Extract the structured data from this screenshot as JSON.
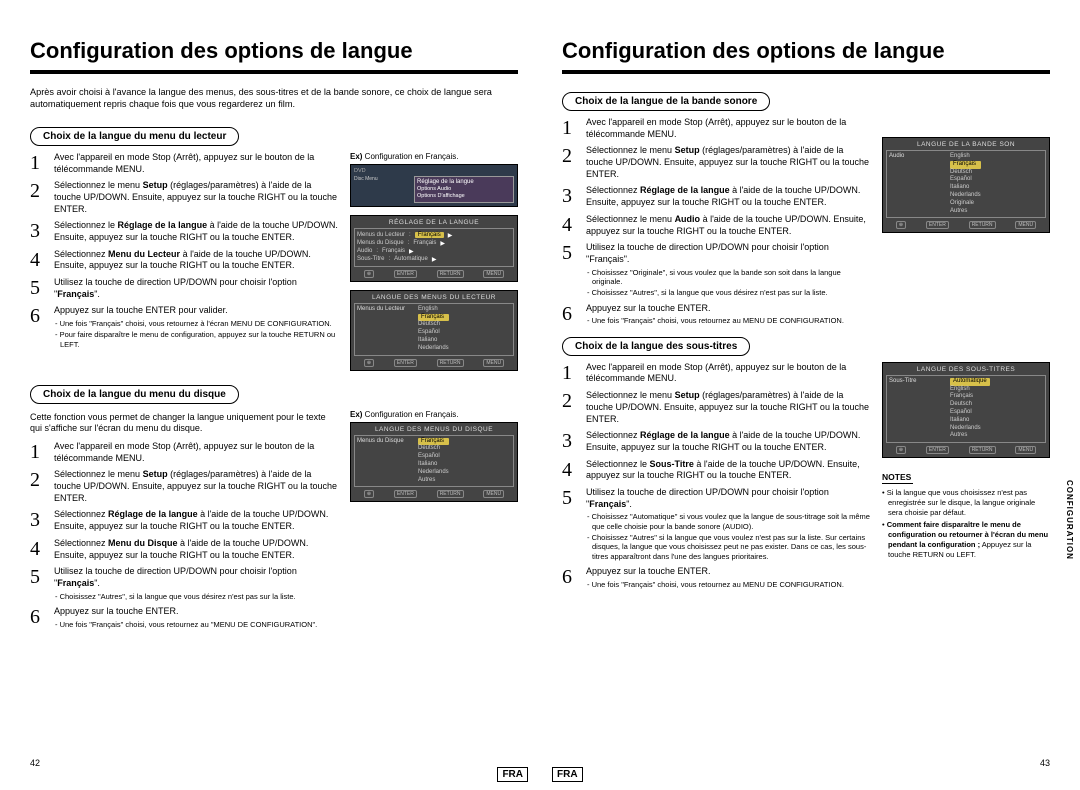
{
  "left": {
    "title": "Configuration des options de langue",
    "intro": "Après avoir choisi à l'avance la langue des menus, des sous-titres et de la bande sonore, ce choix de langue sera automatiquement repris chaque fois que vous regarderez un film.",
    "sec1": {
      "header": "Choix de la langue du menu du lecteur",
      "ex_label_b": "Ex)",
      "ex_label_t": " Configuration en Français.",
      "steps": [
        {
          "t": "Avec l'appareil en mode Stop (Arrêt), appuyez sur le bouton de la télécommande MENU."
        },
        {
          "pre": "Sélectionnez le menu ",
          "bold": "Setup",
          "post": " (réglages/paramètres) à l'aide de la touche UP/DOWN. Ensuite, appuyez sur la touche RIGHT ou la touche ENTER."
        },
        {
          "pre": "Sélectionnez le ",
          "bold": "Réglage de la langue",
          "post": " à l'aide de la touche UP/DOWN. Ensuite, appuyez sur la touche RIGHT ou la touche ENTER."
        },
        {
          "pre": "Sélectionnez ",
          "bold": "Menu du Lecteur",
          "post": " à l'aide de la touche UP/DOWN. Ensuite, appuyez sur la touche RIGHT ou la touche ENTER."
        },
        {
          "pre": "Utilisez la touche de direction UP/DOWN pour choisir l'option \"",
          "bold": "Français",
          "post": "\"."
        },
        {
          "t": "Appuyez sur la touche ENTER pour valider.",
          "sub": [
            "Une fois \"Français\" choisi, vous retournez à l'écran MENU DE CONFIGURATION.",
            "Pour faire disparaître le menu de configuration, appuyez sur la touche RETURN ou LEFT."
          ]
        }
      ],
      "shot1_title": "Réglage de la langue",
      "shot1_items": [
        "Options Audio",
        "Options D'affichage"
      ],
      "shot2_title": "RÉGLAGE DE LA LANGUE",
      "shot2_rows": [
        {
          "l": "Menus du Lecteur",
          "v": "Français"
        },
        {
          "l": "Menus du Disque",
          "v": "Français"
        },
        {
          "l": "Audio",
          "v": "Français"
        },
        {
          "l": "Sous-Titre",
          "v": "Automatique"
        }
      ],
      "shot3_title": "LANGUE DES MENUS DU LECTEUR",
      "shot3_label": "Menus du Lecteur",
      "shot3_opts": [
        "English",
        "Français",
        "Deutsch",
        "Español",
        "Italiano",
        "Nederlands"
      ]
    },
    "sec2": {
      "header": "Choix de la langue du menu du disque",
      "intro": "Cette fonction vous permet de changer la langue uniquement pour le texte qui s'affiche sur l'écran du menu du disque.",
      "ex_label_b": "Ex)",
      "ex_label_t": " Configuration en Français.",
      "steps": [
        {
          "t": "Avec l'appareil en mode Stop (Arrêt), appuyez sur le bouton de la télécommande MENU."
        },
        {
          "pre": "Sélectionnez le menu ",
          "bold": "Setup",
          "post": " (réglages/paramètres) à l'aide de la touche UP/DOWN. Ensuite, appuyez sur la touche RIGHT ou la touche ENTER."
        },
        {
          "pre": "Sélectionnez ",
          "bold": "Réglage de la langue",
          "post": " à l'aide de la touche UP/DOWN. Ensuite, appuyez sur la touche RIGHT ou la touche ENTER."
        },
        {
          "pre": "Sélectionnez ",
          "bold": "Menu du Disque",
          "post": " à l'aide de la touche UP/DOWN. Ensuite, appuyez sur la touche RIGHT ou la touche ENTER."
        },
        {
          "pre": "Utilisez la touche de direction UP/DOWN pour choisir l'option \"",
          "bold": "Français",
          "post": "\".",
          "sub": [
            "Choisissez \"Autres\", si la langue que vous désirez n'est pas sur la liste."
          ]
        },
        {
          "t": "Appuyez sur la touche ENTER.",
          "sub": [
            "Une fois \"Français\" choisi, vous retournez au \"MENU DE CONFIGURATION\"."
          ]
        }
      ],
      "shot_title": "LANGUE DES MENUS DU DISQUE",
      "shot_label": "Menus du Disque",
      "shot_opts": [
        "Français",
        "Deutsch",
        "Español",
        "Italiano",
        "Nederlands",
        "Autres"
      ]
    },
    "pnum": "42",
    "fra": "FRA"
  },
  "right": {
    "title": "Configuration des options de langue",
    "sec1": {
      "header": "Choix de la langue de la bande sonore",
      "steps": [
        {
          "t": "Avec l'appareil en mode Stop (Arrêt), appuyez sur le bouton de la télécommande MENU."
        },
        {
          "pre": "Sélectionnez le menu ",
          "bold": "Setup",
          "post": " (réglages/paramètres) à l'aide de la touche UP/DOWN. Ensuite, appuyez sur la touche RIGHT ou la touche ENTER."
        },
        {
          "pre": "Sélectionnez ",
          "bold": "Réglage de la langue",
          "post": " à l'aide de la touche UP/DOWN. Ensuite, appuyez sur la touche RIGHT ou la touche ENTER."
        },
        {
          "pre": "Sélectionnez le menu ",
          "bold": "Audio",
          "post": " à l'aide de la touche UP/DOWN. Ensuite, appuyez sur la touche RIGHT ou la touche ENTER."
        },
        {
          "pre": "Utilisez la touche de direction UP/DOWN pour choisir l'option \"",
          "nb": "Français",
          "post": "\".",
          "sub": [
            "Choisissez \"Originale\", si vous voulez que la bande son soit dans la langue originale.",
            "Choisissez \"Autres\", si la langue que vous désirez n'est pas sur la liste."
          ]
        },
        {
          "t": "Appuyez sur la touche ENTER.",
          "sub": [
            "Une fois \"Français\" choisi, vous retournez au MENU DE CONFIGURATION."
          ]
        }
      ],
      "shot_title": "LANGUE DE LA BANDE SON",
      "shot_label": "Audio",
      "shot_opts": [
        "English",
        "Français",
        "Deutsch",
        "Español",
        "Italiano",
        "Nederlands",
        "Originale",
        "Autres"
      ]
    },
    "sec2": {
      "header": "Choix de la langue des sous-titres",
      "steps": [
        {
          "t": "Avec l'appareil en mode Stop (Arrêt), appuyez sur le bouton de la télécommande MENU."
        },
        {
          "pre": "Sélectionnez le menu ",
          "bold": "Setup",
          "post": " (réglages/paramètres) à l'aide de la touche UP/DOWN. Ensuite, appuyez sur la touche RIGHT ou la touche ENTER."
        },
        {
          "pre": "Sélectionnez ",
          "bold": "Réglage de la langue",
          "post": " à l'aide de la touche UP/DOWN. Ensuite, appuyez sur la touche RIGHT ou la touche ENTER."
        },
        {
          "pre": "Sélectionnez le ",
          "bold": "Sous-Titre",
          "post": " à l'aide de la touche UP/DOWN. Ensuite, appuyez sur la touche RIGHT ou la touche ENTER."
        },
        {
          "pre": "Utilisez la touche de direction UP/DOWN pour choisir l'option \"",
          "bold": "Français",
          "post": "\".",
          "sub": [
            "Choisissez \"Automatique\" si vous voulez que la langue de sous-titrage soit la même que celle choisie pour la bande sonore (AUDIO).",
            "Choisissez \"Autres\" si la langue que vous voulez n'est pas sur la liste. Sur certains disques, la langue que vous choisissez peut ne pas exister. Dans ce cas, les sous-titres apparaîtront dans l'une des langues prioritaires."
          ]
        },
        {
          "t": "Appuyez sur la touche ENTER.",
          "sub": [
            "Une fois \"Français\" choisi, vous retournez au MENU DE CONFIGURATION."
          ]
        }
      ],
      "shot_title": "LANGUE DES SOUS-TITRES",
      "shot_label": "Sous-Titre",
      "shot_opts": [
        "Automatique",
        "English",
        "Français",
        "Deutsch",
        "Español",
        "Italiano",
        "Nederlands",
        "Autres"
      ]
    },
    "side_tab": "CONFIGURATION",
    "notes_hd": "NOTES",
    "notes": [
      "Si la langue que vous choisissez n'est pas enregistrée sur le disque, la langue originale sera choisie par défaut.",
      "__B__Comment faire disparaître le menu de configuration ou retourner à l'écran du menu pendant la configuration ;__/B__ Appuyez sur la touche RETURN ou LEFT."
    ],
    "pnum": "43",
    "fra": "FRA",
    "shot_buttons": [
      "ENTER",
      "RETURN",
      "MENU"
    ]
  }
}
